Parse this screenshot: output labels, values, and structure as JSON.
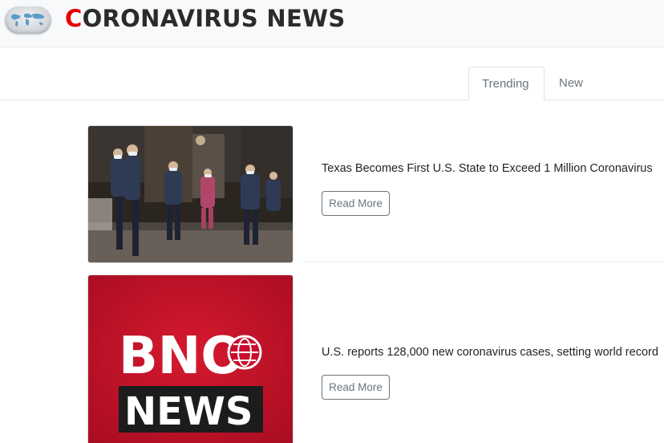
{
  "site": {
    "brand_first": "C",
    "brand_rest": "ORONAVIRUS NEWS",
    "logo_icon": "world-map-icon"
  },
  "tabs": [
    {
      "label": "Trending",
      "active": true
    },
    {
      "label": "New",
      "active": false
    }
  ],
  "articles": [
    {
      "headline": "Texas Becomes First U.S. State to Exceed 1 Million Coronavirus",
      "button_label": "Read More",
      "image": "photo of medical workers walking at night"
    },
    {
      "headline": "U.S. reports 128,000 new coronavirus cases, setting world record",
      "button_label": "Read More",
      "image_text_top": "BNO",
      "image_text_bottom": "NEWS"
    }
  ],
  "colors": {
    "brand_accent": "#e60000",
    "bno_red": "#c8102e"
  }
}
